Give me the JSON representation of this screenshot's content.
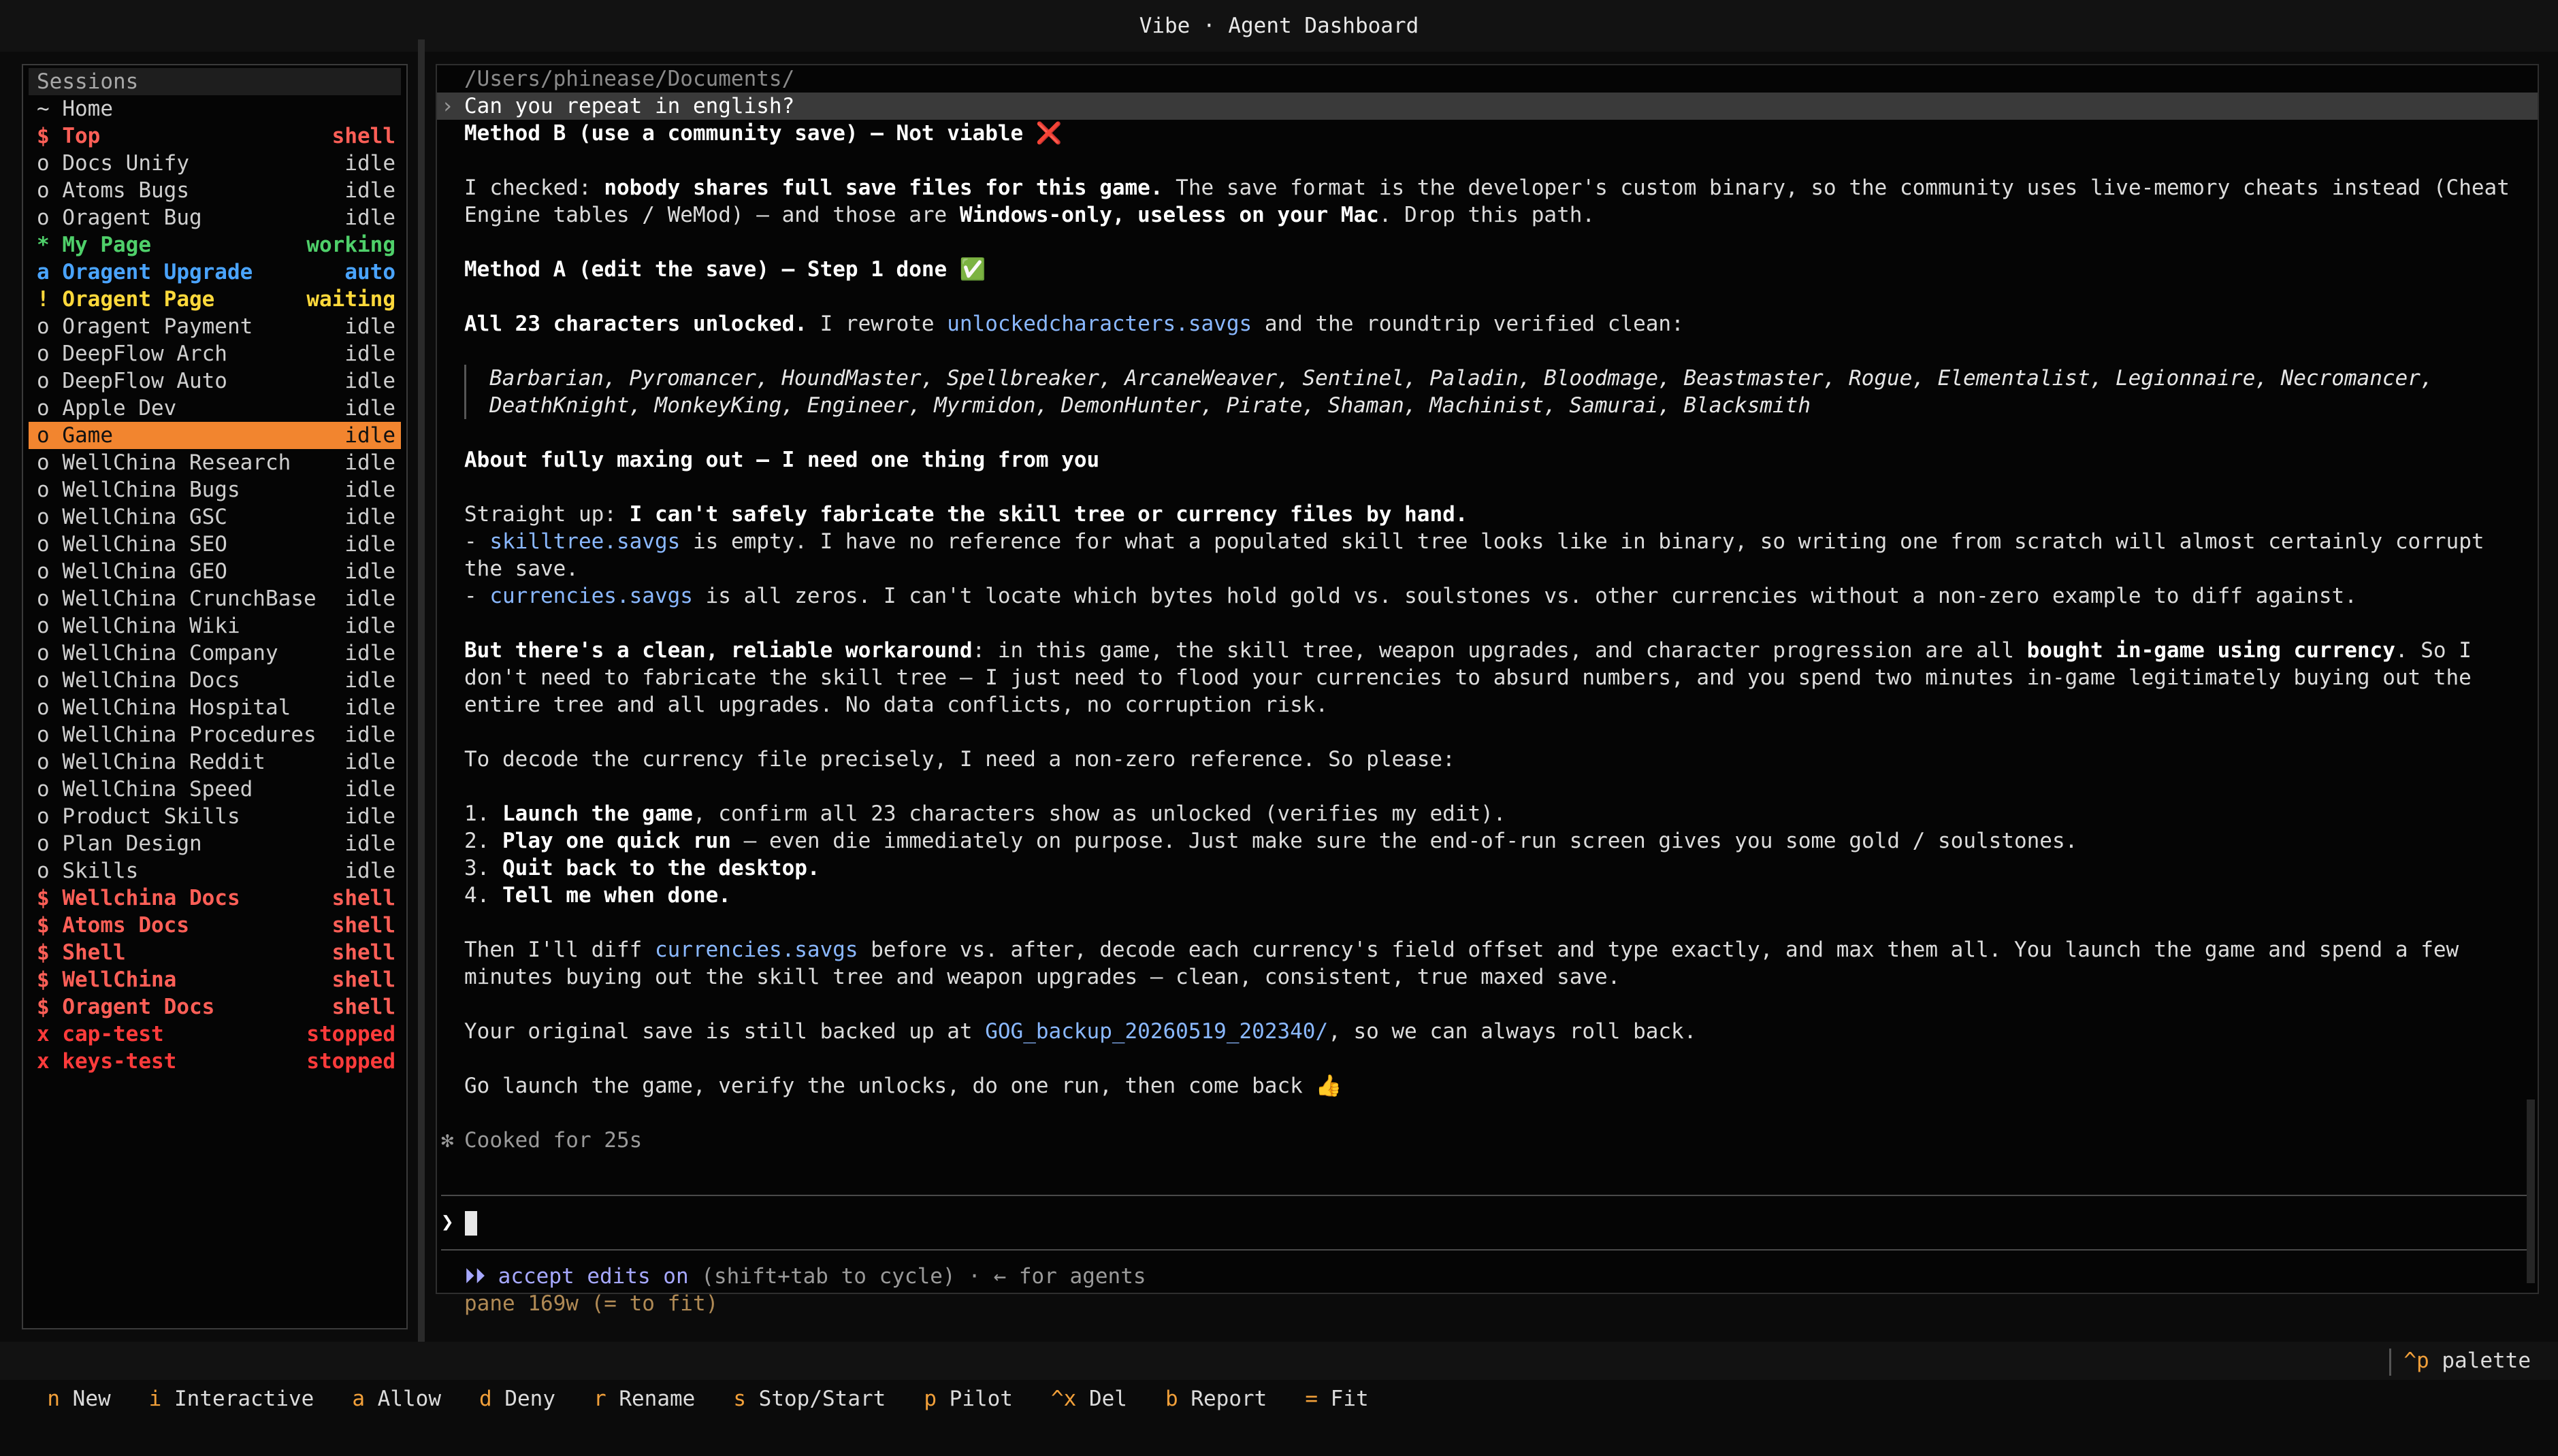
{
  "window": {
    "title": "Vibe · Agent Dashboard"
  },
  "sidebar": {
    "heading": "Sessions",
    "items": [
      {
        "prefix": "~",
        "name": "Home",
        "status": "",
        "kind": "home"
      },
      {
        "prefix": "$",
        "name": "Top",
        "status": "shell",
        "kind": "shell"
      },
      {
        "prefix": "o",
        "name": "Docs Unify",
        "status": "idle",
        "kind": "idle"
      },
      {
        "prefix": "o",
        "name": "Atoms Bugs",
        "status": "idle",
        "kind": "idle"
      },
      {
        "prefix": "o",
        "name": "Oragent Bug",
        "status": "idle",
        "kind": "idle"
      },
      {
        "prefix": "*",
        "name": "My Page",
        "status": "working",
        "kind": "working"
      },
      {
        "prefix": "a",
        "name": "Oragent Upgrade",
        "status": "auto",
        "kind": "auto"
      },
      {
        "prefix": "!",
        "name": "Oragent Page",
        "status": "waiting",
        "kind": "waiting"
      },
      {
        "prefix": "o",
        "name": "Oragent Payment",
        "status": "idle",
        "kind": "idle"
      },
      {
        "prefix": "o",
        "name": "DeepFlow Arch",
        "status": "idle",
        "kind": "idle"
      },
      {
        "prefix": "o",
        "name": "DeepFlow Auto",
        "status": "idle",
        "kind": "idle"
      },
      {
        "prefix": "o",
        "name": "Apple Dev",
        "status": "idle",
        "kind": "idle"
      },
      {
        "prefix": "o",
        "name": "Game",
        "status": "idle",
        "kind": "selected"
      },
      {
        "prefix": "o",
        "name": "WellChina Research",
        "status": "idle",
        "kind": "idle"
      },
      {
        "prefix": "o",
        "name": "WellChina Bugs",
        "status": "idle",
        "kind": "idle"
      },
      {
        "prefix": "o",
        "name": "WellChina GSC",
        "status": "idle",
        "kind": "idle"
      },
      {
        "prefix": "o",
        "name": "WellChina SEO",
        "status": "idle",
        "kind": "idle"
      },
      {
        "prefix": "o",
        "name": "WellChina GEO",
        "status": "idle",
        "kind": "idle"
      },
      {
        "prefix": "o",
        "name": "WellChina CrunchBase",
        "status": "idle",
        "kind": "idle"
      },
      {
        "prefix": "o",
        "name": "WellChina Wiki",
        "status": "idle",
        "kind": "idle"
      },
      {
        "prefix": "o",
        "name": "WellChina Company",
        "status": "idle",
        "kind": "idle"
      },
      {
        "prefix": "o",
        "name": "WellChina Docs",
        "status": "idle",
        "kind": "idle"
      },
      {
        "prefix": "o",
        "name": "WellChina Hospital",
        "status": "idle",
        "kind": "idle"
      },
      {
        "prefix": "o",
        "name": "WellChina Procedures",
        "status": "idle",
        "kind": "idle"
      },
      {
        "prefix": "o",
        "name": "WellChina Reddit",
        "status": "idle",
        "kind": "idle"
      },
      {
        "prefix": "o",
        "name": "WellChina Speed",
        "status": "idle",
        "kind": "idle"
      },
      {
        "prefix": "o",
        "name": "Product Skills",
        "status": "idle",
        "kind": "idle"
      },
      {
        "prefix": "o",
        "name": "Plan Design",
        "status": "idle",
        "kind": "idle"
      },
      {
        "prefix": "o",
        "name": "Skills",
        "status": "idle",
        "kind": "idle"
      },
      {
        "prefix": "$",
        "name": "Wellchina Docs",
        "status": "shell",
        "kind": "shell"
      },
      {
        "prefix": "$",
        "name": "Atoms Docs",
        "status": "shell",
        "kind": "shell"
      },
      {
        "prefix": "$",
        "name": "Shell",
        "status": "shell",
        "kind": "shell"
      },
      {
        "prefix": "$",
        "name": "WellChina",
        "status": "shell",
        "kind": "shell"
      },
      {
        "prefix": "$",
        "name": "Oragent Docs",
        "status": "shell",
        "kind": "shell"
      },
      {
        "prefix": "x",
        "name": "cap-test",
        "status": "stopped",
        "kind": "stopped"
      },
      {
        "prefix": "x",
        "name": "keys-test",
        "status": "stopped",
        "kind": "stopped"
      }
    ]
  },
  "main": {
    "path": "/Users/phinease/Documents/",
    "user_query": "Can you repeat in english?",
    "caret": "›",
    "method_b": "Method B (use a community save) — Not viable ❌",
    "p1": {
      "a": "I checked: ",
      "b": "nobody shares full save files for this game.",
      "c": " The save format is the developer's custom binary, so the community uses live-memory cheats instead (Cheat Engine tables / WeMod) — and those are ",
      "d": "Windows-only, useless on your Mac",
      "e": ". Drop this path."
    },
    "method_a": "Method A (edit the save) — Step 1 done ✅",
    "p2": {
      "a": "All 23 characters unlocked.",
      "b": " I rewrote ",
      "c": "unlockedcharacters.savgs",
      "d": " and the roundtrip verified clean:"
    },
    "characters": "Barbarian, Pyromancer, HoundMaster, Spellbreaker, ArcaneWeaver, Sentinel, Paladin, Bloodmage, Beastmaster, Rogue, Elementalist, Legionnaire, Necromancer, DeathKnight, MonkeyKing, Engineer, Myrmidon, DemonHunter, Pirate, Shaman, Machinist, Samurai, Blacksmith",
    "about": "About fully maxing out — I need one thing from you",
    "p3": {
      "a": "Straight up: ",
      "b": "I can't safely fabricate the skill tree or currency files by hand."
    },
    "bullet1": {
      "dash": "- ",
      "file": "skilltree.savgs",
      "text": " is empty. I have no reference for what a populated skill tree looks like in binary, so writing one from scratch will almost certainly corrupt the save."
    },
    "bullet2": {
      "dash": "- ",
      "file": "currencies.savgs",
      "text": " is all zeros. I can't locate which bytes hold gold vs. soulstones vs. other currencies without a non-zero example to diff against."
    },
    "p4": {
      "a": "But there's a clean, reliable workaround",
      "b": ": in this game, the skill tree, weapon upgrades, and character progression are all ",
      "c": "bought in-game using currency",
      "d": ". So I don't need to fabricate the skill tree — I just need to flood your currencies to absurd numbers, and you spend two minutes in-game legitimately buying out the entire tree and all upgrades. No data conflicts, no corruption risk."
    },
    "p5": "To decode the currency file precisely, I need a non-zero reference. So please:",
    "steps": [
      {
        "n": "1. ",
        "b": "Launch the game",
        "t": ", confirm all 23 characters show as unlocked (verifies my edit)."
      },
      {
        "n": "2. ",
        "b": "Play one quick run",
        "t": " — even die immediately on purpose. Just make sure the end-of-run screen gives you some gold / soulstones."
      },
      {
        "n": "3. ",
        "b": "Quit back to the desktop.",
        "t": ""
      },
      {
        "n": "4. ",
        "b": "Tell me when done.",
        "t": ""
      }
    ],
    "p6": {
      "a": "Then I'll diff ",
      "b": "currencies.savgs",
      "c": " before vs. after, decode each currency's field offset and type exactly, and max them all. You launch the game and spend a few minutes buying out the skill tree and weapon upgrades — clean, consistent, true maxed save."
    },
    "p7": {
      "a": "Your original save is still backed up at ",
      "b": "GOG_backup_20260519_202340/",
      "c": ", so we can always roll back."
    },
    "p8": "Go launch the game, verify the unlocks, do one run, then come back 👍",
    "cooked_star": "✻",
    "cooked": "Cooked for 25s",
    "prompt_symbol": "❯",
    "accept": {
      "arrows": "⏵⏵",
      "label": "accept edits on",
      "rest": " (shift+tab to cycle) · ← for agents"
    },
    "pane": "pane 169w (= to fit)"
  },
  "bottombar": {
    "keys": [
      {
        "k": "n",
        "label": "New"
      },
      {
        "k": "i",
        "label": "Interactive"
      },
      {
        "k": "a",
        "label": "Allow"
      },
      {
        "k": "d",
        "label": "Deny"
      },
      {
        "k": "r",
        "label": "Rename"
      },
      {
        "k": "s",
        "label": "Stop/Start"
      },
      {
        "k": "p",
        "label": "Pilot"
      },
      {
        "k": "^x",
        "label": "Del"
      },
      {
        "k": "b",
        "label": "Report"
      },
      {
        "k": "=",
        "label": "Fit"
      }
    ],
    "palette_key": "^p",
    "palette_label": "palette"
  },
  "colors": {
    "accent": "#f2852f",
    "shell": "#ff5f57",
    "working": "#4fd06a",
    "auto": "#4aa4ff",
    "waiting": "#ffd93b",
    "stopped": "#ff3b3b",
    "link": "#8ab8ff"
  }
}
